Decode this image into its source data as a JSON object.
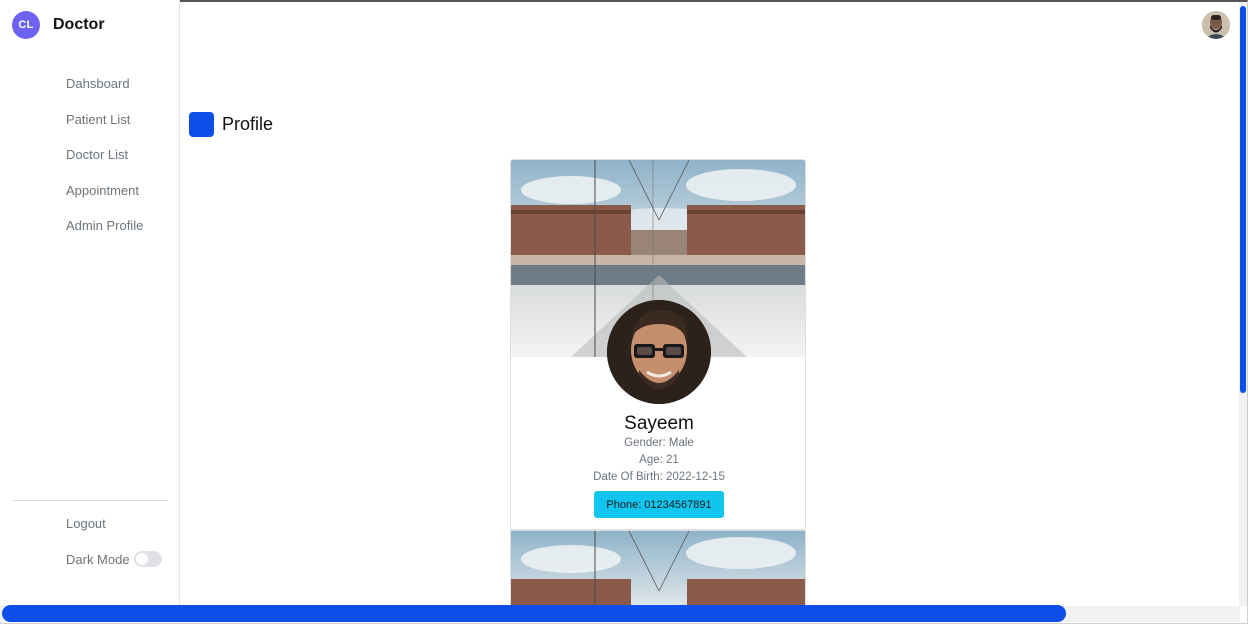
{
  "brand": {
    "logo_text": "CL",
    "name": "Doctor",
    "logo_color": "#6c63f2"
  },
  "sidebar": {
    "items": [
      {
        "label": "Dahsboard"
      },
      {
        "label": "Patient List"
      },
      {
        "label": "Doctor List"
      },
      {
        "label": "Appointment"
      },
      {
        "label": "Admin Profile"
      }
    ],
    "logout": "Logout",
    "dark_mode": "Dark Mode"
  },
  "page": {
    "title": "Profile",
    "accent": "#0d4fe8"
  },
  "profile": {
    "name": "Sayeem",
    "gender": "Gender: Male",
    "age": "Age: 21",
    "dob": "Date Of Birth: 2022-12-15",
    "phone": "Phone: 01234567891",
    "phone_color": "#11c6ee"
  },
  "icons": {
    "top_avatar": "user-avatar-icon",
    "toggle": "dark-mode-toggle"
  },
  "scrollbar": {
    "color": "#0d4fe8"
  }
}
